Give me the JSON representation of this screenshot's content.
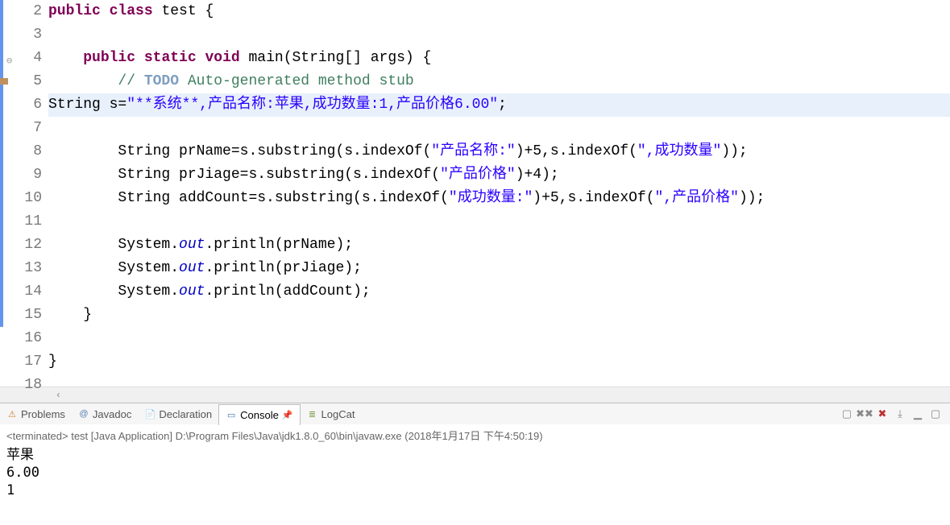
{
  "editor": {
    "lines": {
      "2": {
        "tokens": [
          [
            "kw",
            "public"
          ],
          [
            "p",
            " "
          ],
          [
            "kw",
            "class"
          ],
          [
            "p",
            " test {"
          ]
        ],
        "marker": true
      },
      "3": {
        "tokens": [
          [
            "p",
            ""
          ]
        ],
        "marker": true
      },
      "4": {
        "tokens": [
          [
            "p",
            "    "
          ],
          [
            "kw",
            "public"
          ],
          [
            "p",
            " "
          ],
          [
            "kw",
            "static"
          ],
          [
            "p",
            " "
          ],
          [
            "kw",
            "void"
          ],
          [
            "p",
            " main(String[] args) {"
          ]
        ],
        "marker": true,
        "collapse": true
      },
      "5": {
        "tokens": [
          [
            "p",
            "        "
          ],
          [
            "cmt",
            "// "
          ],
          [
            "todo",
            "TODO"
          ],
          [
            "cmt",
            " Auto-generated method stub"
          ]
        ],
        "marker": true,
        "editmark": true
      },
      "6": {
        "tokens": [
          [
            "p",
            "String s="
          ],
          [
            "str",
            "\"**系统**,产品名称:苹果,成功数量:1,产品价格6.00\""
          ],
          [
            "p",
            ";"
          ]
        ],
        "marker": true,
        "highlight": true
      },
      "7": {
        "tokens": [
          [
            "p",
            ""
          ]
        ],
        "marker": true
      },
      "8": {
        "tokens": [
          [
            "p",
            "        String prName=s.substring(s.indexOf("
          ],
          [
            "str",
            "\"产品名称:\""
          ],
          [
            "p",
            ")+5,s.indexOf("
          ],
          [
            "str",
            "\",成功数量\""
          ],
          [
            "p",
            "));"
          ]
        ],
        "marker": true
      },
      "9": {
        "tokens": [
          [
            "p",
            "        String prJiage=s.substring(s.indexOf("
          ],
          [
            "str",
            "\"产品价格\""
          ],
          [
            "p",
            ")+4);"
          ]
        ],
        "marker": true
      },
      "10": {
        "tokens": [
          [
            "p",
            "        String addCount=s.substring(s.indexOf("
          ],
          [
            "str",
            "\"成功数量:\""
          ],
          [
            "p",
            ")+5,s.indexOf("
          ],
          [
            "str",
            "\",产品价格\""
          ],
          [
            "p",
            "));"
          ]
        ],
        "marker": true
      },
      "11": {
        "tokens": [
          [
            "p",
            ""
          ]
        ],
        "marker": true
      },
      "12": {
        "tokens": [
          [
            "p",
            "        System."
          ],
          [
            "fld",
            "out"
          ],
          [
            "p",
            ".println(prName);"
          ]
        ],
        "marker": true
      },
      "13": {
        "tokens": [
          [
            "p",
            "        System."
          ],
          [
            "fld",
            "out"
          ],
          [
            "p",
            ".println(prJiage);"
          ]
        ],
        "marker": true
      },
      "14": {
        "tokens": [
          [
            "p",
            "        System."
          ],
          [
            "fld",
            "out"
          ],
          [
            "p",
            ".println(addCount);"
          ]
        ],
        "marker": true
      },
      "15": {
        "tokens": [
          [
            "p",
            "    }"
          ]
        ],
        "marker": true
      },
      "16": {
        "tokens": [
          [
            "p",
            ""
          ]
        ]
      },
      "17": {
        "tokens": [
          [
            "p",
            "}"
          ]
        ]
      },
      "18": {
        "tokens": [
          [
            "p",
            ""
          ]
        ]
      }
    },
    "line_order": [
      "2",
      "3",
      "4",
      "5",
      "6",
      "7",
      "8",
      "9",
      "10",
      "11",
      "12",
      "13",
      "14",
      "15",
      "16",
      "17",
      "18"
    ]
  },
  "tabs": {
    "problems": "Problems",
    "javadoc": "Javadoc",
    "declaration": "Declaration",
    "console": "Console",
    "logcat": "LogCat"
  },
  "console": {
    "header": "<terminated> test [Java Application] D:\\Program Files\\Java\\jdk1.8.0_60\\bin\\javaw.exe (2018年1月17日 下午4:50:19)",
    "out1": "苹果",
    "out2": "6.00",
    "out3": "1"
  },
  "icons": {
    "problems": "⚠",
    "javadoc": "@",
    "declaration": "📄",
    "console": "▭",
    "logcat": "≣",
    "pin": "📌",
    "close_all": "✖✖",
    "close": "✖",
    "remove": "▢",
    "scroll_lock": "⤓",
    "min": "▁",
    "max": "▢",
    "chev_left": "‹"
  }
}
